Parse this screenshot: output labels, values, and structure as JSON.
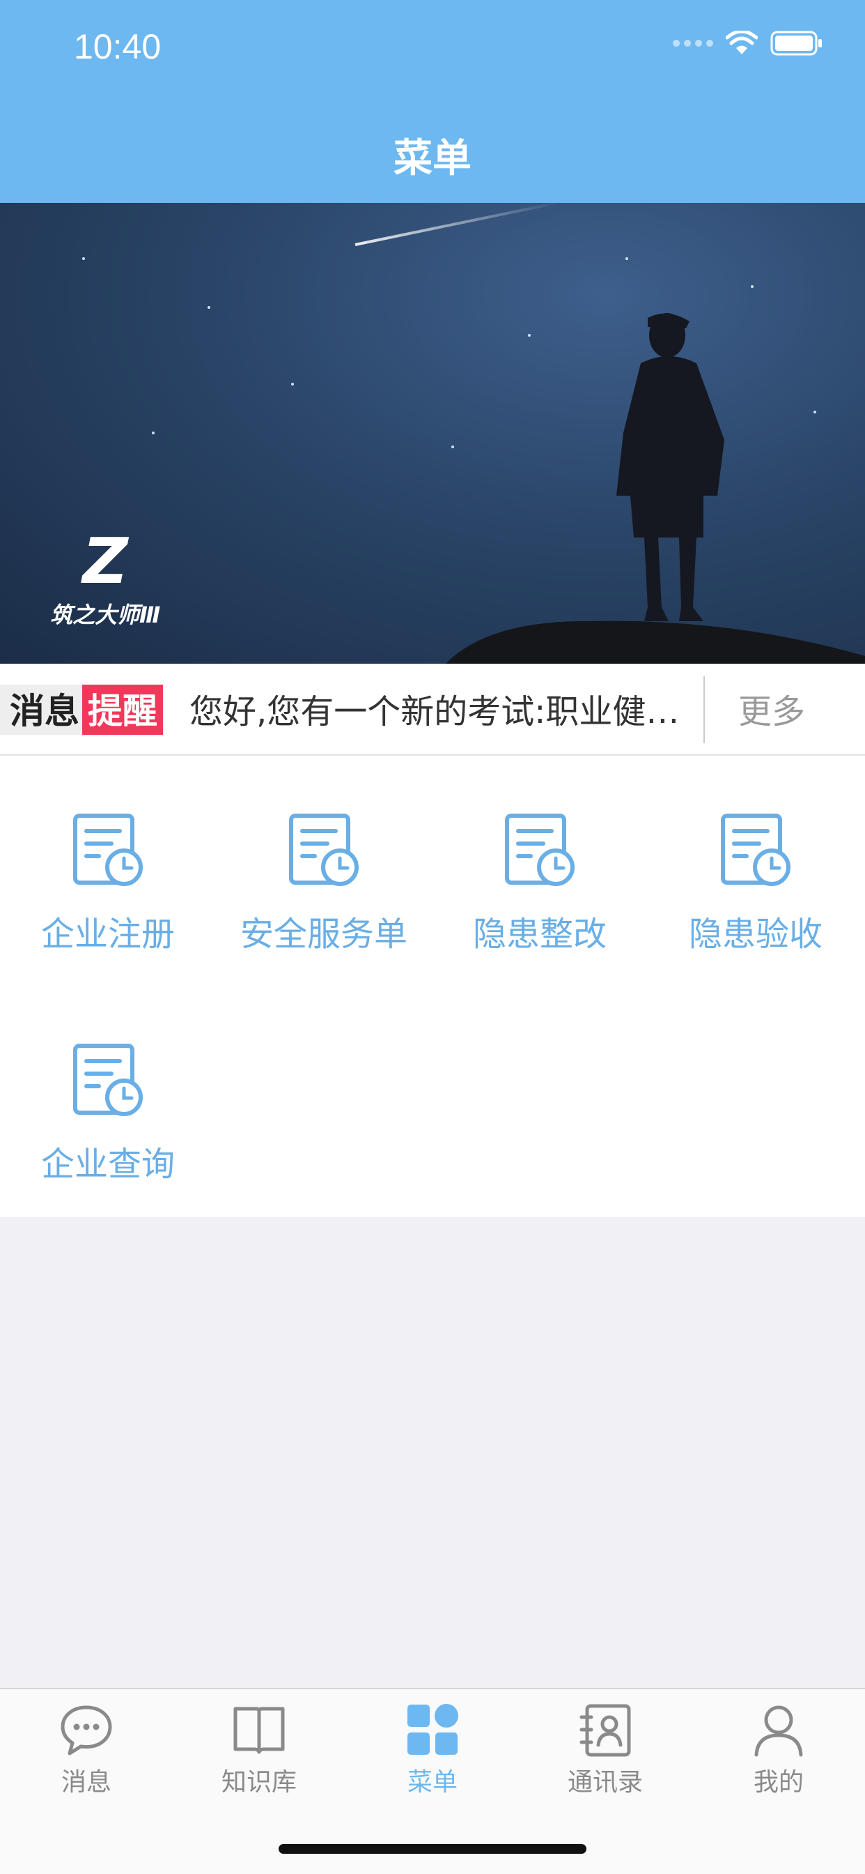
{
  "status_bar": {
    "time": "10:40"
  },
  "header": {
    "title": "菜单"
  },
  "banner": {
    "logo_mark": "Z",
    "logo_text": "筑之大师Ⅲ"
  },
  "notice": {
    "tag_part1": "消息",
    "tag_part2": "提醒",
    "text": "您好,您有一个新的考试:职业健…",
    "more_label": "更多"
  },
  "menu": {
    "items": [
      {
        "label": "企业注册",
        "icon": "document-clock-icon"
      },
      {
        "label": "安全服务单",
        "icon": "document-clock-icon"
      },
      {
        "label": "隐患整改",
        "icon": "document-clock-icon"
      },
      {
        "label": "隐患验收",
        "icon": "document-clock-icon"
      },
      {
        "label": "企业查询",
        "icon": "document-clock-icon"
      }
    ]
  },
  "tabbar": {
    "tabs": [
      {
        "label": "消息",
        "icon": "chat-bubble-icon",
        "active": false
      },
      {
        "label": "知识库",
        "icon": "open-book-icon",
        "active": false
      },
      {
        "label": "菜单",
        "icon": "grid-menu-icon",
        "active": true
      },
      {
        "label": "通讯录",
        "icon": "contacts-icon",
        "active": false
      },
      {
        "label": "我的",
        "icon": "person-icon",
        "active": false
      }
    ]
  },
  "colors": {
    "primary": "#6db8f0",
    "menu_label": "#6aaee6",
    "notice_tag_red": "#f2385a",
    "background": "#f0f0f5"
  }
}
